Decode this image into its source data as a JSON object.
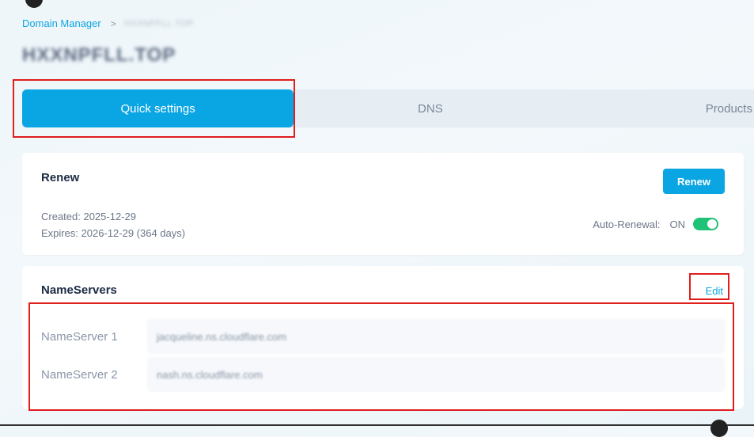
{
  "breadcrumb": {
    "root": "Domain Manager",
    "separator": ">",
    "current": "HXXNPFLL.TOP"
  },
  "page": {
    "title": "HXXNPFLL.TOP"
  },
  "tabs": [
    {
      "label": "Quick settings",
      "active": true
    },
    {
      "label": "DNS",
      "active": false
    },
    {
      "label": "Products",
      "active": false
    }
  ],
  "renew": {
    "title": "Renew",
    "button_label": "Renew",
    "created": "Created: 2025-12-29",
    "expires": "Expires: 2026-12-29 (364 days)",
    "auto_renewal_label": "Auto-Renewal:",
    "auto_renewal_state": "ON",
    "auto_renewal_on": true
  },
  "nameservers": {
    "title": "NameServers",
    "edit_label": "Edit",
    "items": [
      {
        "label": "NameServer 1",
        "value": "jacqueline.ns.cloudflare.com"
      },
      {
        "label": "NameServer 2",
        "value": "nash.ns.cloudflare.com"
      }
    ]
  },
  "colors": {
    "accent": "#0aa5e3",
    "toggle_on": "#20c277",
    "highlight": "#e01e1e"
  },
  "icons": {
    "separator": "chevron-right-icon"
  }
}
